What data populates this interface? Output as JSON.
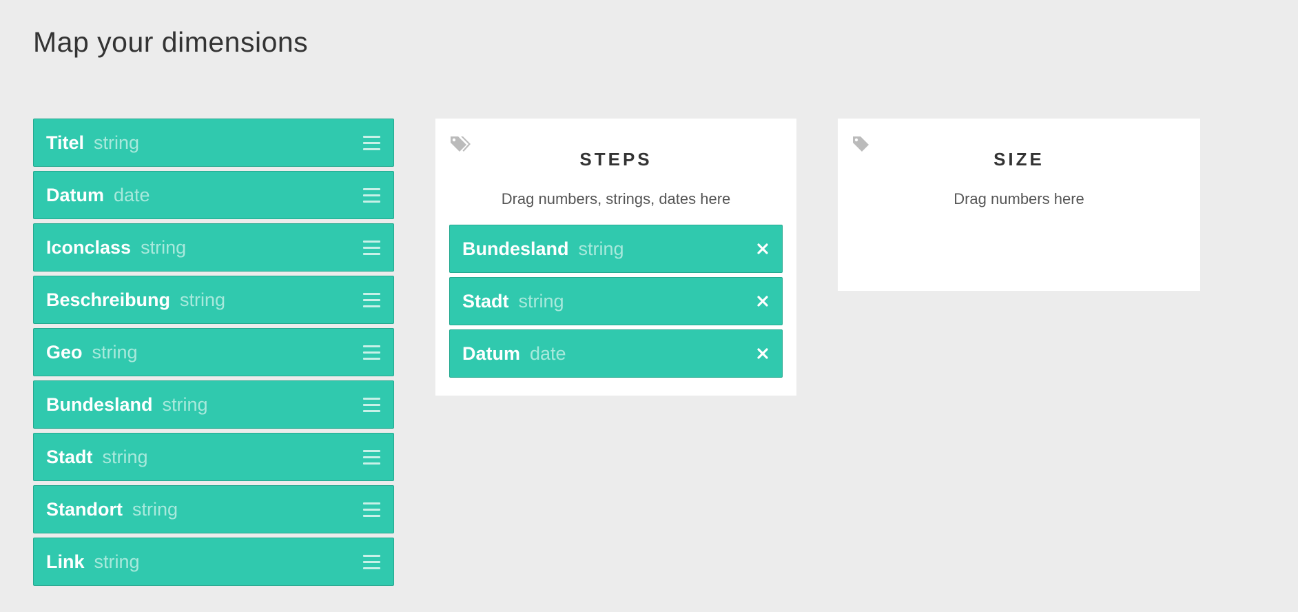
{
  "page": {
    "title": "Map your dimensions"
  },
  "dimensions": [
    {
      "name": "Titel",
      "type": "string"
    },
    {
      "name": "Datum",
      "type": "date"
    },
    {
      "name": "Iconclass",
      "type": "string"
    },
    {
      "name": "Beschreibung",
      "type": "string"
    },
    {
      "name": "Geo",
      "type": "string"
    },
    {
      "name": "Bundesland",
      "type": "string"
    },
    {
      "name": "Stadt",
      "type": "string"
    },
    {
      "name": "Standort",
      "type": "string"
    },
    {
      "name": "Link",
      "type": "string"
    }
  ],
  "steps_panel": {
    "icon": "tags-icon",
    "title": "STEPS",
    "hint": "Drag numbers, strings, dates here",
    "items": [
      {
        "name": "Bundesland",
        "type": "string"
      },
      {
        "name": "Stadt",
        "type": "string"
      },
      {
        "name": "Datum",
        "type": "date"
      }
    ]
  },
  "size_panel": {
    "icon": "tag-icon",
    "title": "SIZE",
    "hint": "Drag numbers here"
  },
  "colors": {
    "background": "#ececec",
    "accent": "#30c9ae",
    "accent_border": "#23a98f",
    "type_text": "#a8e9dc",
    "panel": "#ffffff",
    "icon_gray": "#bbbbbb"
  }
}
